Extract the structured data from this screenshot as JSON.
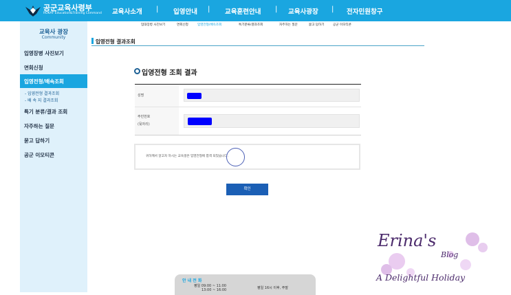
{
  "header": {
    "logo_title": "공군교육사령부",
    "logo_sub": "ROKAF Education&Training Command",
    "nav": [
      "교육사소개",
      "입영안내",
      "교육훈련안내",
      "교육사광장",
      "전자민원창구"
    ],
    "separator": "|"
  },
  "sidebar": {
    "title": "교육사 광장",
    "subtitle": "Community",
    "items": [
      "입영장병 사진보기",
      "면회신청",
      "입영전형/배속조회",
      "특기 분류/결과 조회",
      "자주하는 질문",
      "묻고 답하기",
      "공군 이모티콘"
    ],
    "active_index": 2,
    "sub_items": [
      "- 입영전형 결과조회",
      "- 배 속 지  결과조회"
    ]
  },
  "subtabs": [
    "입대장병 사진보기",
    "면회신청",
    "입영전형/배속조회",
    "특기분류/결과조회",
    "자주하는 질문",
    "묻고 답하기",
    "공군 이모티콘"
  ],
  "page": {
    "title": "입영전형 결과조회",
    "section_title": "입영전형 조회 결과",
    "fields": [
      {
        "label": "성명"
      },
      {
        "label_line1": "주민번호",
        "label_line2": "(뒷자리)"
      }
    ],
    "result_message": "귀하께서 알고자 하시는 교육생은 입영전형에 합격 되었습니다.",
    "confirm_label": "확인"
  },
  "info": {
    "title": "안 내 전 화",
    "line1": "평일 09:00 ~ 11:00",
    "line2": "13:00 ~ 16:00",
    "line3": "평일 16시 이후, 주말"
  },
  "watermark": {
    "line1": "Erina's",
    "line2": "Blog",
    "line3": "A Delightful Holiday"
  },
  "colors": {
    "accent": "#1aa6e0",
    "masked": "#0000ff",
    "button": "#1b5fb5"
  }
}
